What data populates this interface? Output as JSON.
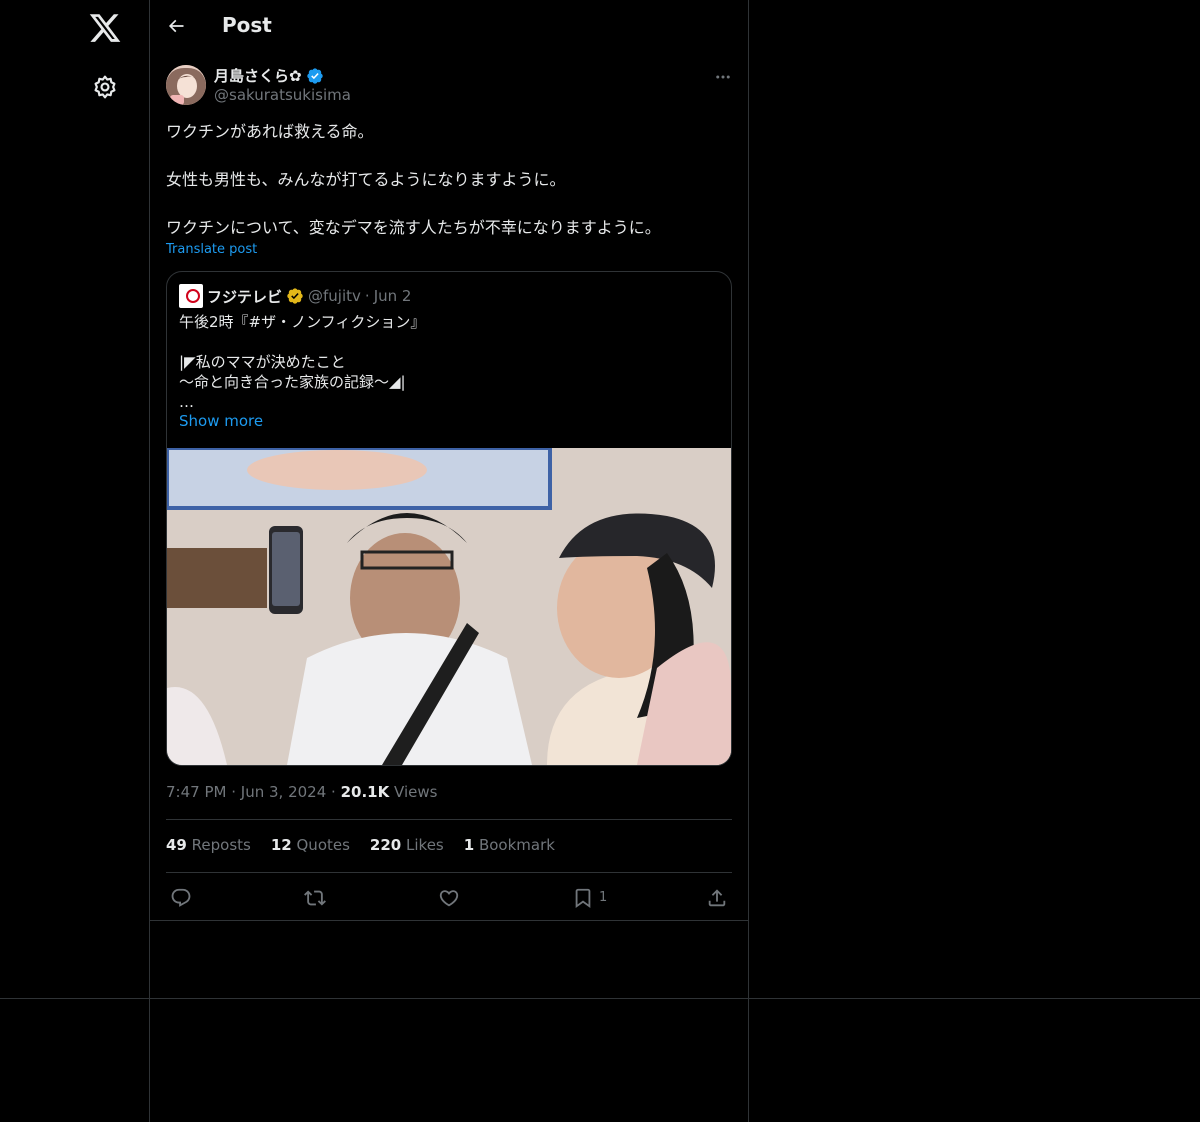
{
  "header": {
    "title": "Post"
  },
  "tweet": {
    "display_name": "月島さくら✿",
    "handle": "@sakuratsukisima",
    "lines": [
      "ワクチンがあれば救える命。",
      "",
      "女性も男性も、みんなが打てるようになりますように。",
      "",
      "ワクチンについて、変なデマを流す人たちが不幸になりますように。"
    ],
    "translate_label": "Translate post",
    "time": "7:47 PM",
    "date": "Jun 3, 2024",
    "views_count": "20.1K",
    "views_label": "Views",
    "separator": "·"
  },
  "quote": {
    "name": "フジテレビ",
    "handle": "@fujitv",
    "separator": "·",
    "date": "Jun 2",
    "lines": [
      "午後2時『#ザ・ノンフィクション』",
      "",
      "|◤私のママが決めたこと",
      "〜命と向き合った家族の記録〜◢|",
      "…"
    ],
    "show_more": "Show more"
  },
  "stats": {
    "reposts_count": "49",
    "reposts_label": "Reposts",
    "quotes_count": "12",
    "quotes_label": "Quotes",
    "likes_count": "220",
    "likes_label": "Likes",
    "bookmarks_count": "1",
    "bookmarks_label": "Bookmark"
  },
  "actions": {
    "bookmark_count": "1"
  },
  "colors": {
    "accent": "#1d9bf0",
    "verified_gold": "#e2b719",
    "background": "#000000",
    "border": "#2f3336",
    "muted": "#71767b"
  },
  "icons": [
    "x-logo-icon",
    "settings-gear-icon",
    "back-arrow-icon",
    "verified-badge-icon",
    "more-icon",
    "reply-icon",
    "repost-icon",
    "like-icon",
    "bookmark-icon",
    "share-icon"
  ]
}
